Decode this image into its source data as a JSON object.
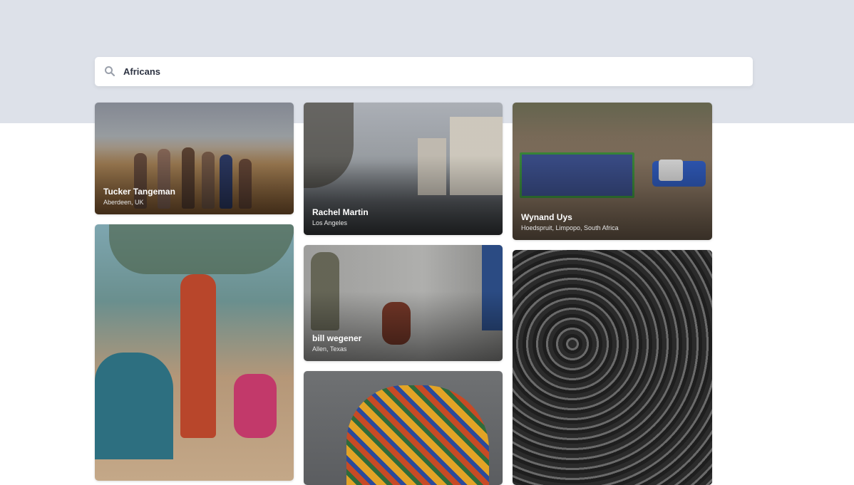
{
  "search": {
    "value": "Africans",
    "placeholder": "Search"
  },
  "results": [
    {
      "name": "Tucker Tangeman",
      "location": "Aberdeen, UK"
    },
    {
      "name": "Rachel Martin",
      "location": "Los Angeles"
    },
    {
      "name": "Wynand Uys",
      "location": "Hoedspruit, Limpopo, South Africa"
    },
    {
      "name": "bill wegener",
      "location": "Allen, Texas"
    }
  ],
  "colors": {
    "header_band": "#dde1e9",
    "search_text": "#2d3342",
    "icon": "#9aa0ab"
  }
}
